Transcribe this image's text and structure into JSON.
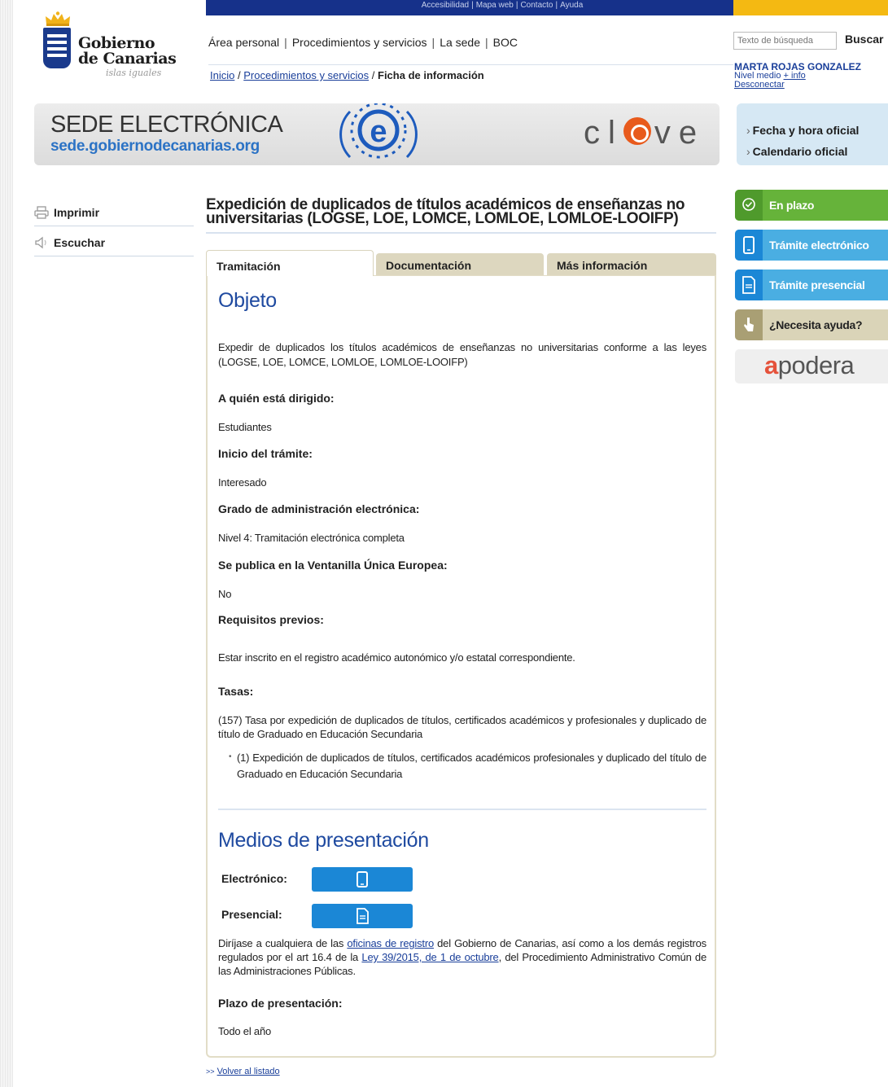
{
  "header": {
    "top_links": [
      "Accesibilidad",
      "Mapa web",
      "Contacto",
      "Ayuda"
    ],
    "logo_line1": "Gobierno",
    "logo_line2": "de Canarias",
    "logo_tagline": "islas iguales",
    "nav": [
      "Área personal",
      "Procedimientos y servicios",
      "La sede",
      "BOC"
    ],
    "breadcrumb": {
      "home": "Inicio",
      "procedures": "Procedimientos y servicios",
      "separator": "/",
      "current": "Ficha de información"
    },
    "search": {
      "placeholder": "Texto de búsqueda",
      "button": "Buscar"
    },
    "user": {
      "name": "MARTA ROJAS GONZALEZ",
      "level": "Nivel medio",
      "level_link": "+ info",
      "logout": "Desconectar"
    }
  },
  "banner": {
    "sede_title": "SEDE ELECTRÓNICA",
    "sede_url": "sede.gobiernodecanarias.org",
    "e_letter": "e",
    "clave_left": "cl",
    "clave_right": "ve",
    "side_links": [
      "Fecha y hora oficial",
      "Calendario oficial"
    ]
  },
  "tools": {
    "print": "Imprimir",
    "listen": "Escuchar"
  },
  "procedure": {
    "title_line1": "Expedición de duplicados de títulos académicos de enseñanzas no",
    "title_line2": "universitarias (LOGSE, LOE, LOMCE, LOMLOE, LOMLOE-LOOIFP)"
  },
  "tabs": [
    "Tramitación",
    "Documentación",
    "Más información"
  ],
  "content": {
    "objeto_heading": "Objeto",
    "objeto_text": "Expedir de duplicados los títulos académicos de enseñanzas no universitarias conforme a las leyes (LOGSE, LOE, LOMCE, LOMLOE, LOMLOE-LOOIFP)",
    "dirigido_label": "A quién está dirigido:",
    "dirigido_value": "Estudiantes",
    "inicio_label": "Inicio del trámite:",
    "inicio_value": "Interesado",
    "grado_label": "Grado de administración electrónica:",
    "grado_value": "Nivel 4: Tramitación electrónica completa",
    "ventanilla_label": "Se publica en la Ventanilla Única Europea:",
    "ventanilla_value": "No",
    "requisitos_label": "Requisitos previos:",
    "requisitos_value": "Estar inscrito en el registro académico autonómico y/o estatal correspondiente.",
    "tasas_label": "Tasas:",
    "tasas_value": "(157) Tasa por expedición de duplicados de títulos, certificados académicos y profesionales y duplicado de título de Graduado en Educación Secundaria",
    "tasas_item": "(1) Expedición de duplicados de títulos, certificados académicos profesionales y duplicado del título de Graduado en Educación Secundaria",
    "medios_heading": "Medios de presentación",
    "electronico_label": "Electrónico:",
    "presencial_label": "Presencial:",
    "presencial_text_1": "Diríjase a cualquiera de las",
    "presencial_link_1": "oficinas de registro",
    "presencial_text_2": "del Gobierno de Canarias, así como a los demás registros regulados por el art 16.4 de la",
    "presencial_link_2": "Ley 39/2015, de 1 de octubre",
    "presencial_text_3": ", del Procedimiento Administrativo Común de las Administraciones Públicas.",
    "plazo_label": "Plazo de presentación:",
    "plazo_value": "Todo el año"
  },
  "back_link": {
    "arrows": ">>",
    "label": "Volver al listado"
  },
  "sidebar_right": {
    "en_plazo": "En plazo",
    "tramite_electronico": "Trámite electrónico",
    "tramite_presencial": "Trámite presencial",
    "ayuda": "¿Necesita ayuda?",
    "apodera_a": "a",
    "apodera_rest": "podera"
  }
}
